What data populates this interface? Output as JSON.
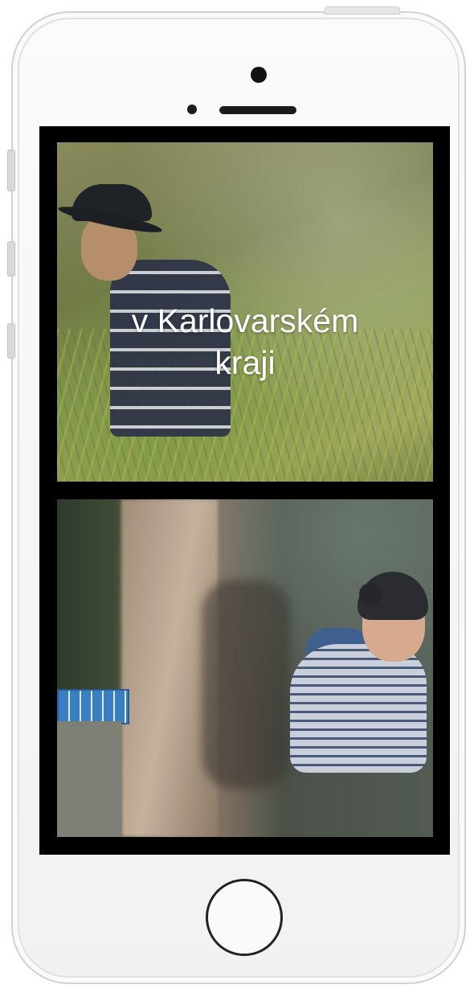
{
  "device": {
    "type": "iPhone",
    "color": "#f2f2f2"
  },
  "screen": {
    "panels": [
      {
        "scene": "man-in-hat-walking-through-grass",
        "caption_lines": [
          "v Karlovarském",
          "kraji"
        ]
      },
      {
        "scene": "woman-in-beanie-climbing-rock-near-train"
      }
    ]
  },
  "icons": {
    "front_camera": "camera-icon",
    "home_button": "home-button"
  }
}
